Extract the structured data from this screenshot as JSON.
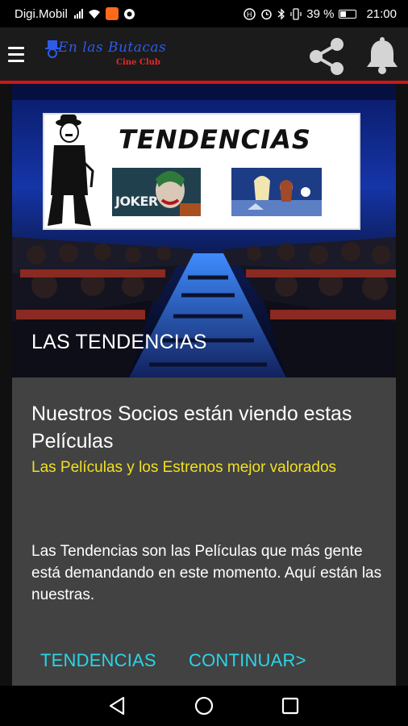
{
  "status_bar": {
    "carrier": "Digi.Mobil",
    "battery": "39 %",
    "time": "21:00",
    "icons": [
      "signal-icon",
      "wifi-icon",
      "app-notification-icon",
      "headset-icon",
      "alarm-icon",
      "bluetooth-icon",
      "vibrate-icon",
      "battery-icon"
    ]
  },
  "app_bar": {
    "logo_script": "En las Butacas",
    "logo_sub": "Cine Club",
    "icons": [
      "menu-icon",
      "share-icon",
      "bell-icon"
    ]
  },
  "hero": {
    "screen_title": "TENDENCIAS",
    "poster_text": "JOKER",
    "title": "LAS TENDENCIAS"
  },
  "card": {
    "headline": "Nuestros Socios están viendo estas Películas",
    "subline": "Las Películas y los Estrenos mejor valorados",
    "description": "Las Tendencias son las Películas que más gente está demandando en este momento. Aquí están las nuestras.",
    "buttons": {
      "tendencias": "TENDENCIAS",
      "continuar": "CONTINUAR>"
    }
  },
  "colors": {
    "accent_red": "#d01515",
    "button_cyan": "#2ad5e6",
    "subline_yellow": "#f0e020",
    "card_bg": "#424242"
  },
  "nav_bar": {
    "icons": [
      "back-icon",
      "home-icon",
      "recents-icon"
    ]
  }
}
